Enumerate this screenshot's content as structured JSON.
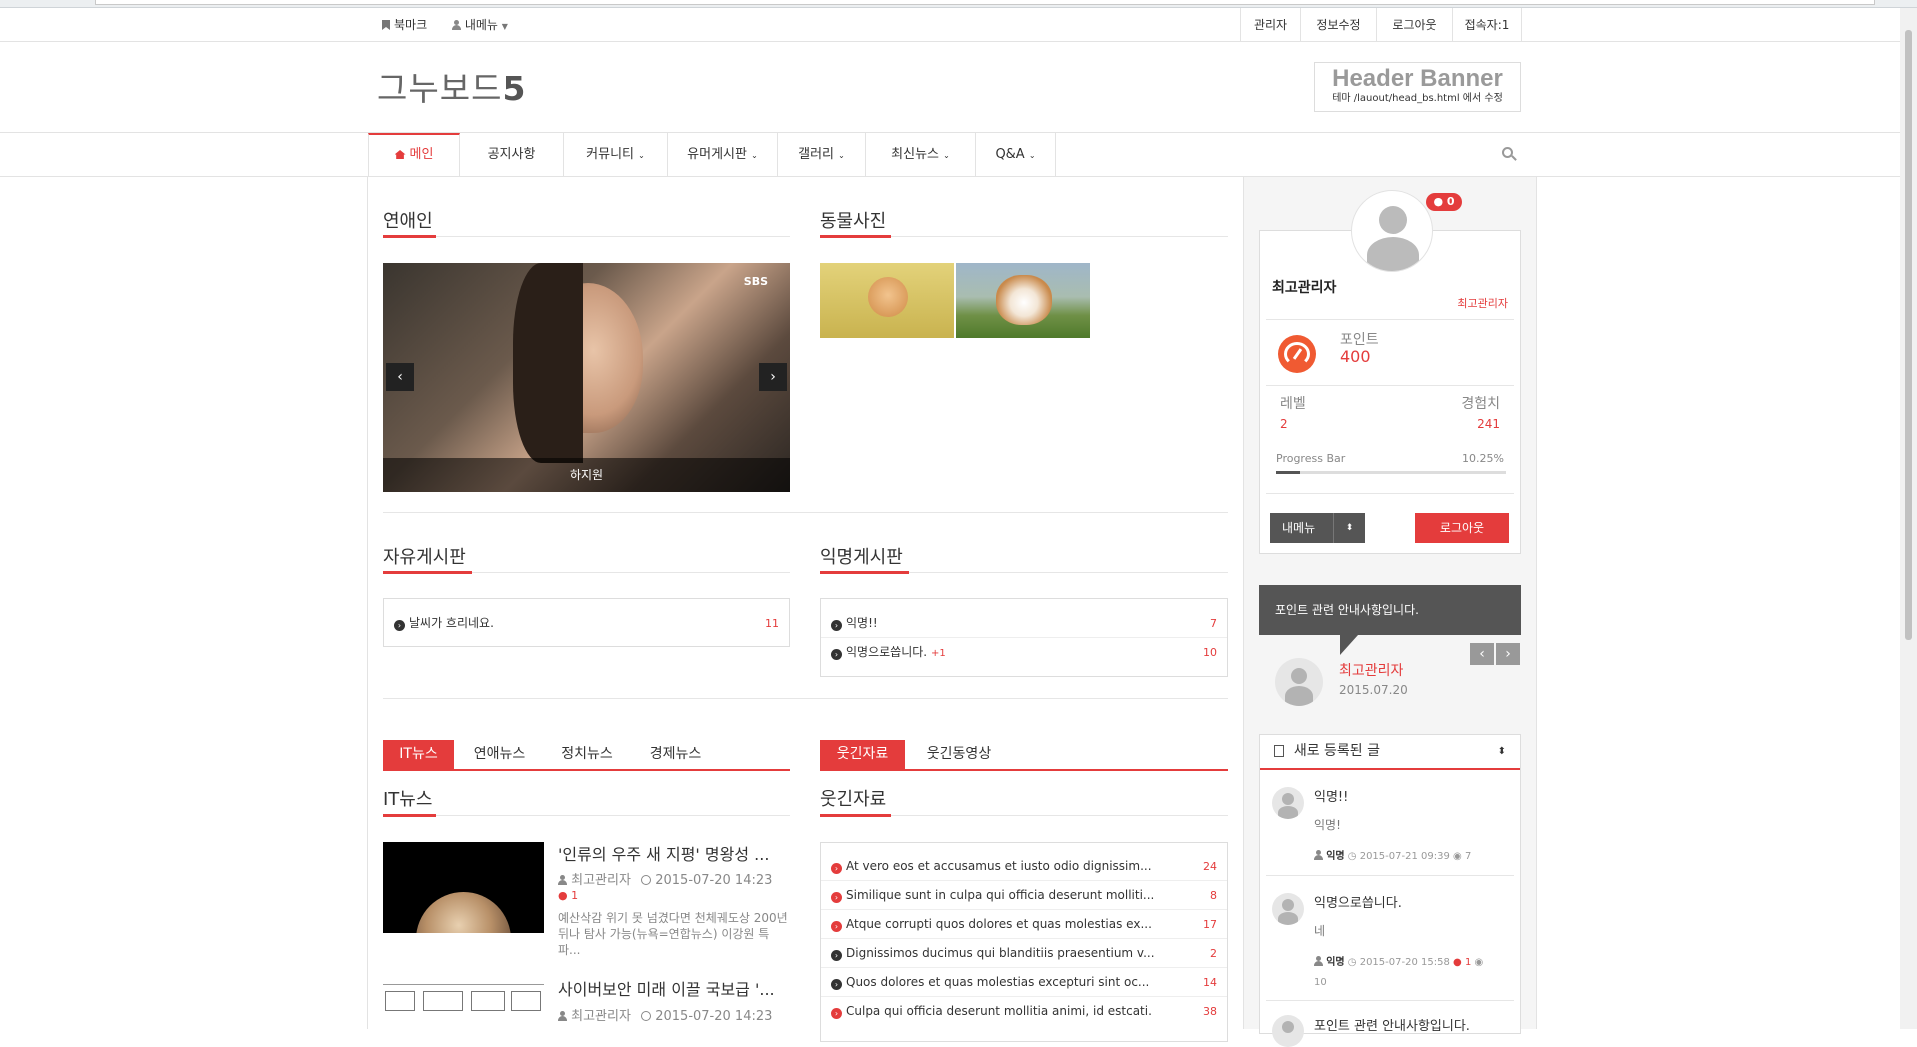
{
  "topbar": {
    "bookmark": "북마크",
    "mymenu": "내메뉴",
    "admin": "관리자",
    "edit_info": "정보수정",
    "logout": "로그아웃",
    "visitors": "접속자:1"
  },
  "header": {
    "logo_text": "그누보드",
    "logo_num": "5",
    "banner_title": "Header Banner",
    "banner_sub": "테마 /lauout/head_bs.html 에서 수정"
  },
  "nav": {
    "items": [
      "메인",
      "공지사항",
      "커뮤니티",
      "유머게시판",
      "갤러리",
      "최신뉴스",
      "Q&A"
    ]
  },
  "celeb": {
    "title": "연애인",
    "caption": "하지원",
    "watermark": "SBS"
  },
  "animals": {
    "title": "동물사진"
  },
  "free_board": {
    "title": "자유게시판",
    "rows": [
      {
        "text": "날씨가 흐리네요.",
        "count": "11"
      }
    ]
  },
  "anon_board": {
    "title": "익명게시판",
    "rows": [
      {
        "text": "익명!!",
        "extra": "",
        "count": "7"
      },
      {
        "text": "익명으로씁니다.",
        "extra": "+1",
        "count": "10"
      }
    ]
  },
  "news": {
    "tabs": [
      "IT뉴스",
      "연애뉴스",
      "정치뉴스",
      "경제뉴스"
    ],
    "title": "IT뉴스",
    "items": [
      {
        "title": "'인류의 우주 새 지평' 명왕성 ...",
        "author": "최고관리자",
        "date": "2015-07-20 14:23",
        "comments": "1",
        "summary": "예산삭감 위기 못 넘겼다면 천체궤도상 200년 뒤나 탐사 가능(뉴욕=연합뉴스) 이강원 특파..."
      },
      {
        "title": "사이버보안 미래 이끌 국보급 '...",
        "author": "최고관리자",
        "date": "2015-07-20 14:23"
      }
    ]
  },
  "funny": {
    "tabs": [
      "웃긴자료",
      "웃긴동영상"
    ],
    "title": "웃긴자료",
    "rows": [
      {
        "text": "At vero eos et accusamus et iusto odio dignissim...",
        "count": "24"
      },
      {
        "text": "Similique sunt in culpa qui officia deserunt molliti...",
        "count": "8"
      },
      {
        "text": "Atque corrupti quos dolores et quas molestias ex...",
        "count": "17"
      },
      {
        "text": "Dignissimos ducimus qui blanditiis praesentium v...",
        "count": "2"
      },
      {
        "text": "Quos dolores et quas molestias excepturi sint oc...",
        "count": "14"
      },
      {
        "text": "Culpa qui officia deserunt mollitia animi, id estcati.",
        "count": "38"
      }
    ]
  },
  "profile": {
    "memo_count": "0",
    "name": "최고관리자",
    "role": "최고관리자",
    "point_label": "포인트",
    "point_value": "400",
    "level_label": "레벨",
    "level_value": "2",
    "exp_label": "경험치",
    "exp_value": "241",
    "progress_label": "Progress Bar",
    "progress_text": "10.25%",
    "progress": 0.1025,
    "mymenu_btn": "내메뉴",
    "logout_btn": "로그아웃"
  },
  "notice": {
    "text": "포인트 관련 안내사항입니다.",
    "author": "최고관리자",
    "date": "2015.07.20"
  },
  "recent": {
    "title": "새로 등록된 글",
    "items": [
      {
        "title": "익명!!",
        "body": "익명!",
        "author": "익명",
        "date": "2015-07-21 09:39",
        "views": "7",
        "comments": ""
      },
      {
        "title": "익명으로씁니다.",
        "body": "네",
        "author": "익명",
        "date": "2015-07-20 15:58",
        "comments": "1",
        "views": "10"
      },
      {
        "title": "포인트 관련 안내사항입니다."
      }
    ]
  },
  "colors": {
    "accent": "#e43c3c",
    "dark": "#555555"
  }
}
